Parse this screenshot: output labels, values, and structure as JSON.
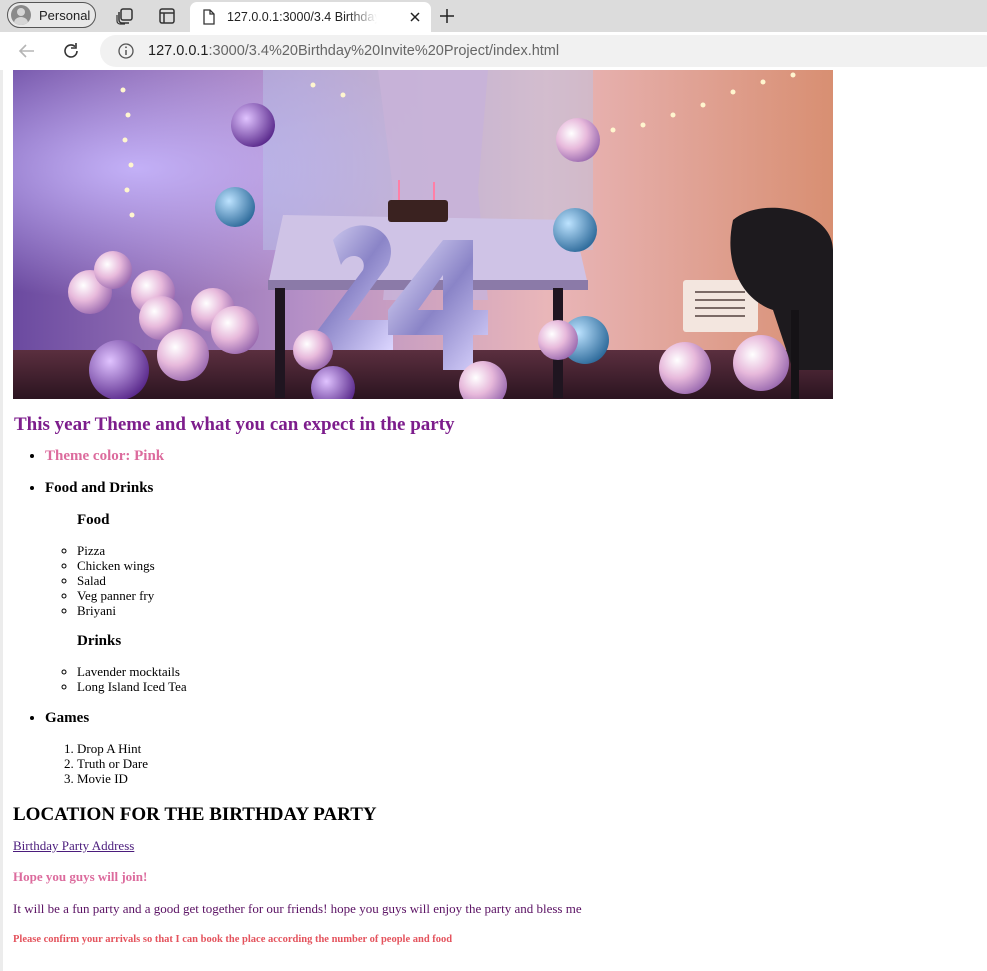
{
  "browser": {
    "profile_label": "Personal",
    "tab_title": "127.0.0.1:3000/3.4 Birthday Invite Project/index.html",
    "url_host": "127.0.0.1",
    "url_rest": ":3000/3.4%20Birthday%20Invite%20Project/index.html",
    "icons": [
      "avatar-icon",
      "collections-icon",
      "tab-actions-icon",
      "file-icon",
      "close-icon",
      "plus-icon",
      "back-arrow-icon",
      "reload-icon",
      "info-icon"
    ]
  },
  "page": {
    "hero_image": "birthday-party-photo",
    "theme_heading": "This year Theme and what you can expect in the party",
    "theme_color": "Theme color: Pink",
    "food_and_drinks": "Food and Drinks",
    "food_heading": "Food",
    "food_items": [
      "Pizza",
      "Chicken wings",
      "Salad",
      "Veg panner fry",
      "Briyani"
    ],
    "drinks_heading": "Drinks",
    "drink_items": [
      "Lavender mocktails",
      "Long Island Iced Tea"
    ],
    "games_heading": "Games",
    "games": [
      "Drop A Hint",
      "Truth or Dare",
      "Movie ID"
    ],
    "location_heading": "LOCATION FOR THE BIRTHDAY PARTY",
    "address_link": "Birthday Party Address",
    "hope_text": "Hope you guys will join!",
    "fun_text": "It will be a fun party and a good get together for our friends! hope you guys will enjoy the party and bless me",
    "confirm_text": "Please confirm your arrivals so that I can book the place according the number of people and food"
  },
  "colors": {
    "theme_heading": "#7d1d8c",
    "pink": "#dc6b9d",
    "link": "#4b1c7c",
    "fun_text": "#5a1163",
    "confirm_text": "#e4535d"
  }
}
